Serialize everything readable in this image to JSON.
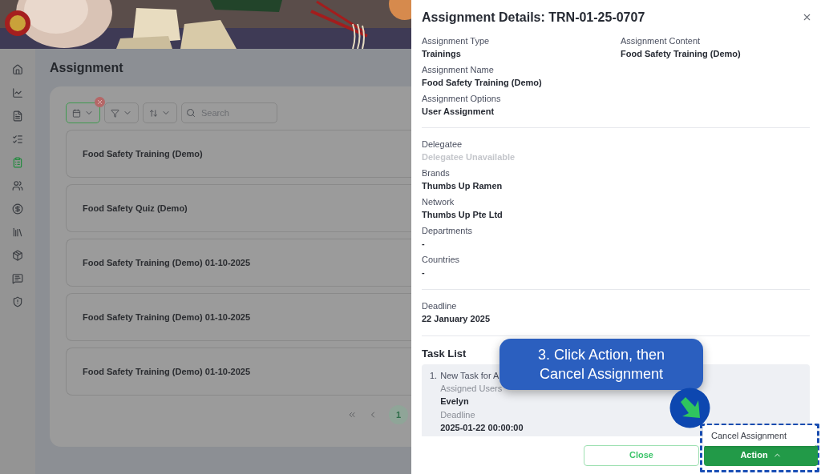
{
  "sidebar": {
    "items": [
      {
        "selected": false
      },
      {
        "selected": false
      },
      {
        "selected": false
      },
      {
        "selected": false
      },
      {
        "selected": true
      },
      {
        "selected": false
      },
      {
        "selected": false
      },
      {
        "selected": false
      },
      {
        "selected": false
      },
      {
        "selected": false
      },
      {
        "selected": false
      }
    ]
  },
  "page": {
    "title": "Assignment",
    "filters": [
      {
        "kind": "date",
        "active": true
      },
      {
        "kind": "filter",
        "active": false
      },
      {
        "kind": "sort",
        "active": false
      }
    ],
    "search": {
      "placeholder": "Search"
    },
    "items": [
      "Food Safety Training (Demo)",
      "Food Safety Quiz (Demo)",
      "Food Safety Training (Demo) 01-10-2025",
      "Food Safety Training (Demo) 01-10-2025",
      "Food Safety Training (Demo) 01-10-2025"
    ],
    "pagination": {
      "pages": [
        {
          "label": "1",
          "selected": true
        }
      ]
    }
  },
  "drawer": {
    "title": "Assignment Details: TRN-01-25-0707",
    "sections": [
      [
        {
          "label": "Assignment Type",
          "value": "Trainings",
          "disabled": false
        },
        {
          "label": "Assignment Content",
          "value": "Food Safety Training (Demo)",
          "disabled": false
        },
        {
          "label": "Assignment Name",
          "value": "Food Safety Training (Demo)",
          "disabled": false
        },
        {
          "label": "Assignment Options",
          "value": "User Assignment",
          "disabled": false
        }
      ],
      [
        {
          "label": "Delegatee",
          "value": "Delegatee Unavailable",
          "disabled": true
        },
        {
          "label": "Brands",
          "value": "Thumbs Up Ramen",
          "disabled": false
        },
        {
          "label": "Network",
          "value": "Thumbs Up Pte Ltd",
          "disabled": false
        },
        {
          "label": "Departments",
          "value": "-",
          "disabled": false
        },
        {
          "label": "Countries",
          "value": "-",
          "disabled": false
        }
      ],
      [
        {
          "label": "Deadline",
          "value": "22 January 2025",
          "disabled": false
        }
      ]
    ],
    "task_list": {
      "title": "Task List",
      "tasks": [
        {
          "number": "1.",
          "name": "New Task for A",
          "fields": [
            {
              "label": "Assigned Users",
              "value": "Evelyn"
            },
            {
              "label": "Deadline",
              "value": "2025-01-22 00:00:00"
            }
          ]
        }
      ]
    },
    "close_button": "Close",
    "action_button": {
      "label": "Action",
      "expanded": true
    },
    "action_menu": [
      "Cancel Assignment"
    ]
  },
  "callout": {
    "text": "3. Click Action, then Cancel Assignment"
  }
}
